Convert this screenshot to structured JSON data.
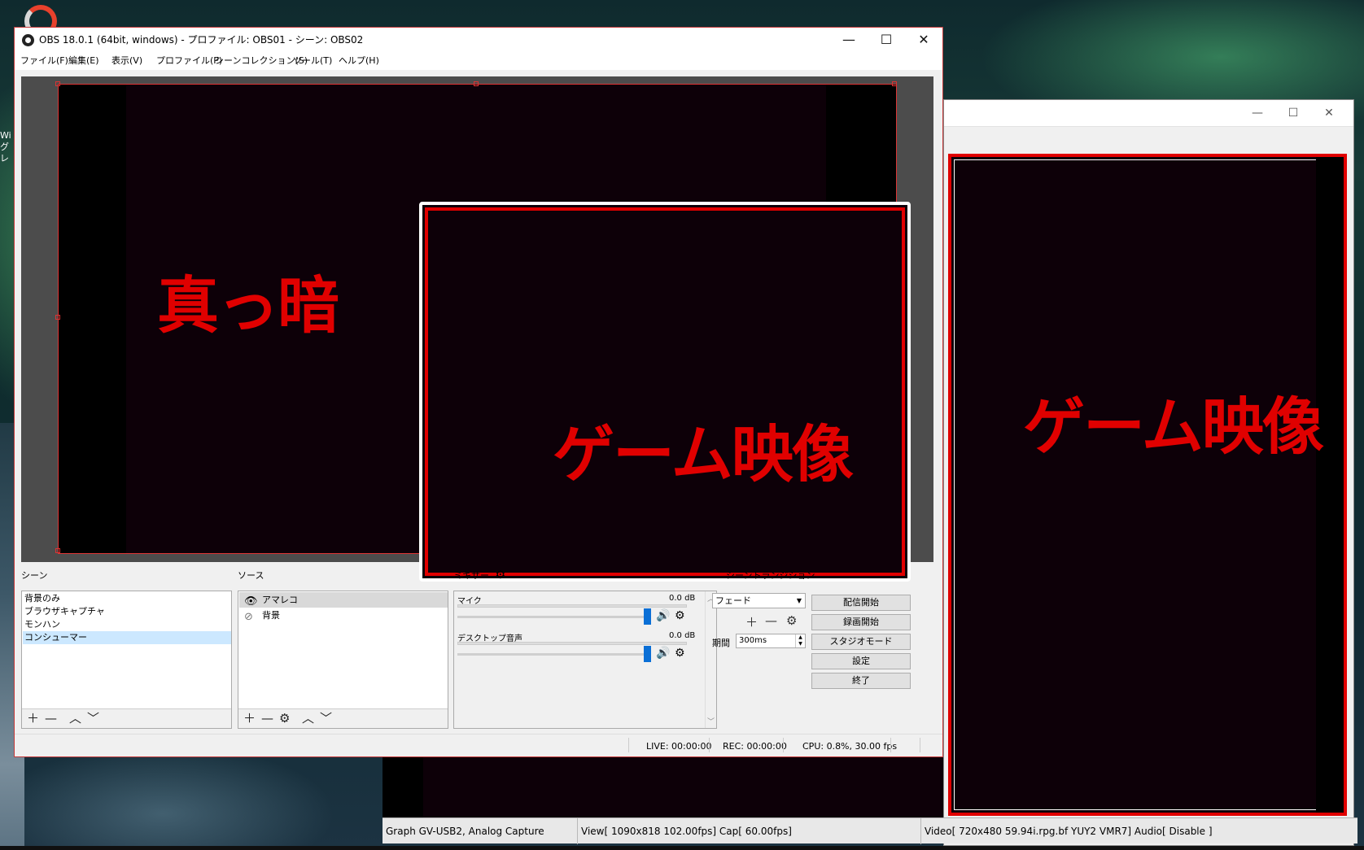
{
  "obs": {
    "title": "OBS 18.0.1 (64bit, windows) - プロファイル: OBS01 - シーン: OBS02",
    "menu": [
      "ファイル(F)",
      "編集(E)",
      "表示(V)",
      "プロファイル(P)",
      "シーンコレクション(S)",
      "ツール(T)",
      "ヘルプ(H)"
    ],
    "window_controls": {
      "minimize": "—",
      "maximize": "☐",
      "close": "✕"
    }
  },
  "preview": {
    "dark_label": "真っ暗",
    "game_label": "ゲーム映像"
  },
  "scenes": {
    "title": "シーン",
    "items": [
      "背景のみ",
      "ブラウザキャプチャ",
      "モンハン",
      "コンシューマー"
    ],
    "selected": "コンシューマー"
  },
  "sources": {
    "title": "ソース",
    "items": [
      "アマレコ",
      "背景"
    ],
    "selected": "アマレコ"
  },
  "mixer": {
    "title": "ミキサー",
    "channels": [
      {
        "name": "マイク",
        "db": "0.0 dB",
        "level": 1.0
      },
      {
        "name": "デスクトップ音声",
        "db": "0.0 dB",
        "level": 1.0
      }
    ]
  },
  "transitions": {
    "title": "シーントランジション",
    "selected": "フェード",
    "duration_label": "期間",
    "duration_value": "300ms"
  },
  "controls": {
    "start_streaming": "配信開始",
    "start_recording": "録画開始",
    "studio_mode": "スタジオモード",
    "settings": "設定",
    "exit": "終了"
  },
  "status": {
    "live": "LIVE: 00:00:00",
    "rec": "REC: 00:00:00",
    "cpu": "CPU: 0.8%, 30.00 fps"
  },
  "capture_window": {
    "game_label": "ゲーム映像",
    "status": {
      "device": "Graph GV-USB2, Analog Capture",
      "view": "View[ 1090x818 102.00fps]  Cap[ 60.00fps]",
      "video": "Video[ 720x480 59.94i.rpg.bf YUY2 VMR7]  Audio[ Disable ]"
    }
  },
  "desktop": {
    "icon_text": "Wi グレ"
  },
  "colors": {
    "accent_red": "#e00000",
    "canvas_dark": "#0d0008",
    "selection_blue": "#cce8ff",
    "slider_blue": "#0a6fd6"
  }
}
